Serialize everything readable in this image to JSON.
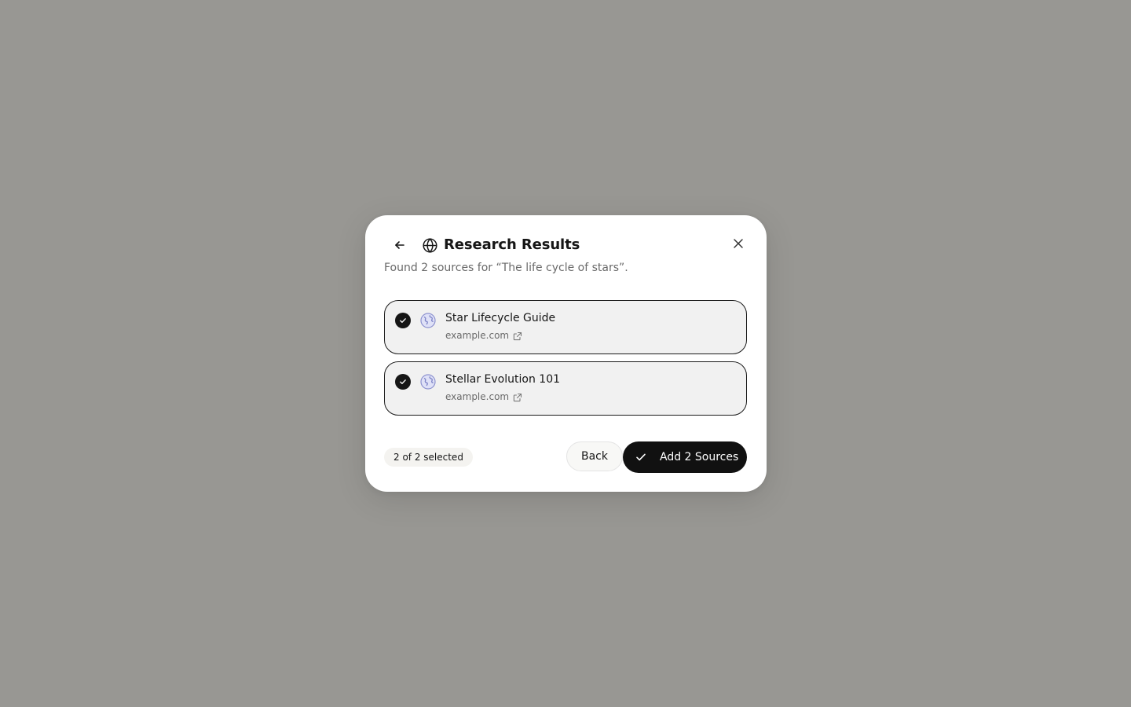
{
  "dialog": {
    "title": "Research Results",
    "subtitle": "Found 2 sources for “The life cycle of stars”."
  },
  "sources": [
    {
      "title": "Star Lifecycle Guide",
      "domain": "example.com",
      "selected": true
    },
    {
      "title": "Stellar Evolution 101",
      "domain": "example.com",
      "selected": true
    }
  ],
  "footer": {
    "selection_count": "2 of 2 selected",
    "back_label": "Back",
    "add_label": "Add 2 Sources"
  },
  "icons": {
    "back": "arrow-left-icon",
    "title": "globe-icon",
    "close": "close-icon",
    "check": "check-icon",
    "favicon": "globe-favicon-icon",
    "external": "external-link-icon"
  },
  "colors": {
    "backdrop": "#989793",
    "primary_button": "#111111",
    "item_background": "#f1f1f1"
  }
}
